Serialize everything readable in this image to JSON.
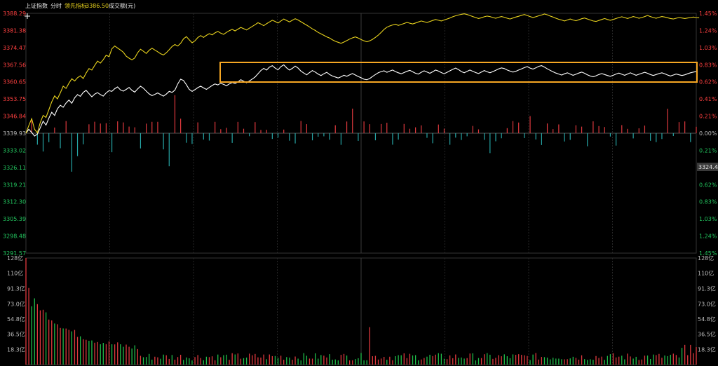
{
  "header": {
    "index_name": "上证指数",
    "mode": "分时",
    "leading_label": "领先指标:",
    "leading_value": "3386.50",
    "volume_label": "成交额(元)"
  },
  "price_ticks": [
    "3388.29",
    "3381.38",
    "3374.47",
    "3367.56",
    "3360.65",
    "3353.75",
    "3346.84",
    "3339.93",
    "3333.02",
    "3326.11",
    "3319.21",
    "3312.30",
    "3305.39",
    "3298.48",
    "3291.57"
  ],
  "pct_ticks": [
    "1.45%",
    "1.24%",
    "1.03%",
    "0.83%",
    "0.62%",
    "0.41%",
    "0.21%",
    "0.00%",
    "0.21%",
    "0.41%",
    "0.62%",
    "0.83%",
    "1.03%",
    "1.24%",
    "1.45%"
  ],
  "volume_ticks": [
    "128亿",
    "110亿",
    "91.3亿",
    "73.0亿",
    "54.8亿",
    "36.5亿",
    "18.3亿"
  ],
  "cursor_price": "3324.40",
  "colors": {
    "background": "#000000",
    "index_line": "#ffffff",
    "leading_line": "#e8d21d",
    "up": "#e0393e",
    "down": "#26a6a6",
    "volume_down": "#1fbf4a",
    "grid": "#2e2e2e",
    "highlight": "#f5a623",
    "tick_up": "#ff4040",
    "tick_down": "#22c55e"
  },
  "chart_data": {
    "type": "line",
    "title": "上证指数 分时",
    "base_price": 3339.93,
    "ylim": [
      3291.57,
      3388.29
    ],
    "volume_ylim": [
      0,
      128
    ],
    "volume_unit": "亿",
    "x_session": "241 one-minute points",
    "series": [
      {
        "name": "上证指数",
        "color": "white",
        "values": [
          3339.93,
          3341.5,
          3340.2,
          3338.8,
          3339.6,
          3342.1,
          3344.8,
          3343.2,
          3346.0,
          3348.4,
          3347.1,
          3349.8,
          3351.2,
          3350.4,
          3352.1,
          3353.3,
          3352.0,
          3354.2,
          3355.5,
          3354.8,
          3356.4,
          3357.2,
          3355.9,
          3354.6,
          3355.7,
          3356.3,
          3355.5,
          3354.9,
          3356.2,
          3357.1,
          3356.8,
          3357.9,
          3358.6,
          3357.4,
          3356.9,
          3357.6,
          3358.4,
          3357.2,
          3356.5,
          3357.8,
          3358.9,
          3358.1,
          3356.9,
          3355.8,
          3355.1,
          3355.6,
          3356.2,
          3355.5,
          3354.9,
          3355.7,
          3356.8,
          3356.4,
          3357.3,
          3359.8,
          3361.7,
          3361.2,
          3359.5,
          3357.6,
          3356.8,
          3357.5,
          3358.3,
          3358.9,
          3358.2,
          3357.6,
          3358.4,
          3359.2,
          3359.8,
          3359.4,
          3360.1,
          3359.6,
          3359.1,
          3359.8,
          3360.4,
          3360.0,
          3360.6,
          3361.5,
          3360.9,
          3360.3,
          3361.0,
          3361.8,
          3362.6,
          3363.9,
          3365.2,
          3366.1,
          3365.4,
          3366.6,
          3367.2,
          3366.2,
          3365.5,
          3366.8,
          3367.5,
          3366.3,
          3365.4,
          3366.1,
          3367.0,
          3366.2,
          3365.0,
          3364.2,
          3363.5,
          3364.4,
          3365.2,
          3364.6,
          3363.8,
          3363.2,
          3363.9,
          3364.5,
          3363.6,
          3363.0,
          3362.6,
          3362.2,
          3362.7,
          3363.3,
          3362.9,
          3363.5,
          3364.0,
          3363.4,
          3362.8,
          3362.3,
          3361.7,
          3361.5,
          3362.0,
          3362.8,
          3363.6,
          3364.3,
          3364.8,
          3365.1,
          3364.5,
          3365.0,
          3365.4,
          3364.8,
          3364.3,
          3363.9,
          3364.4,
          3364.9,
          3365.3,
          3364.7,
          3364.1,
          3363.8,
          3364.5,
          3365.1,
          3364.6,
          3364.1,
          3364.7,
          3365.4,
          3365.0,
          3364.4,
          3363.9,
          3364.5,
          3365.1,
          3365.7,
          3366.2,
          3365.6,
          3364.8,
          3364.3,
          3364.9,
          3365.4,
          3364.9,
          3364.4,
          3364.0,
          3364.6,
          3365.2,
          3364.7,
          3364.3,
          3364.8,
          3365.3,
          3365.9,
          3366.3,
          3366.0,
          3365.4,
          3365.0,
          3364.6,
          3364.9,
          3365.4,
          3365.9,
          3366.4,
          3366.8,
          3366.2,
          3365.8,
          3366.3,
          3366.9,
          3367.2,
          3366.6,
          3365.9,
          3365.3,
          3364.7,
          3364.2,
          3363.8,
          3363.4,
          3363.9,
          3364.3,
          3363.8,
          3363.3,
          3363.7,
          3364.2,
          3364.6,
          3364.1,
          3363.5,
          3363.0,
          3362.7,
          3363.1,
          3363.6,
          3364.0,
          3363.6,
          3363.2,
          3362.9,
          3363.3,
          3363.8,
          3364.2,
          3363.7,
          3363.3,
          3363.8,
          3364.3,
          3363.8,
          3363.3,
          3363.7,
          3364.1,
          3364.5,
          3364.1,
          3363.6,
          3363.2,
          3363.6,
          3364.0,
          3364.3,
          3363.9,
          3363.4,
          3363.0,
          3363.4,
          3363.8,
          3363.5,
          3363.2,
          3363.5,
          3363.9,
          3364.3,
          3364.6,
          3364.8
        ]
      },
      {
        "name": "领先指标",
        "color": "yellow",
        "values": [
          3339.93,
          3343.0,
          3345.8,
          3341.5,
          3340.1,
          3344.2,
          3347.1,
          3346.3,
          3349.4,
          3352.6,
          3355.0,
          3353.8,
          3356.2,
          3358.9,
          3358.0,
          3360.1,
          3361.9,
          3361.0,
          3362.3,
          3363.1,
          3362.0,
          3364.2,
          3366.0,
          3365.4,
          3367.3,
          3369.0,
          3368.2,
          3369.6,
          3371.4,
          3370.8,
          3374.0,
          3375.1,
          3374.3,
          3373.5,
          3372.6,
          3371.0,
          3370.2,
          3369.5,
          3370.3,
          3372.4,
          3373.8,
          3373.0,
          3372.1,
          3373.4,
          3374.2,
          3373.5,
          3372.8,
          3372.0,
          3371.5,
          3372.4,
          3373.6,
          3374.9,
          3375.7,
          3375.1,
          3376.2,
          3378.0,
          3378.9,
          3377.6,
          3376.4,
          3377.2,
          3378.5,
          3379.3,
          3378.6,
          3379.4,
          3380.1,
          3379.6,
          3380.4,
          3381.0,
          3380.3,
          3379.8,
          3380.6,
          3381.3,
          3381.8,
          3381.2,
          3381.9,
          3382.6,
          3382.1,
          3381.6,
          3382.3,
          3383.0,
          3383.7,
          3384.5,
          3384.0,
          3383.3,
          3384.1,
          3384.8,
          3385.5,
          3385.0,
          3384.4,
          3385.2,
          3386.0,
          3385.4,
          3384.8,
          3385.5,
          3386.1,
          3385.6,
          3384.9,
          3384.2,
          3383.5,
          3382.8,
          3382.0,
          3381.4,
          3380.6,
          3380.0,
          3379.4,
          3378.8,
          3378.3,
          3377.6,
          3377.0,
          3376.6,
          3376.2,
          3376.7,
          3377.3,
          3377.9,
          3378.4,
          3378.8,
          3378.3,
          3377.7,
          3377.2,
          3376.8,
          3377.2,
          3377.8,
          3378.6,
          3379.5,
          3380.6,
          3381.8,
          3382.7,
          3383.2,
          3383.6,
          3383.9,
          3383.4,
          3383.8,
          3384.2,
          3384.6,
          3384.3,
          3384.0,
          3384.4,
          3384.8,
          3385.2,
          3384.9,
          3384.6,
          3385.0,
          3385.4,
          3385.8,
          3385.5,
          3385.2,
          3385.6,
          3386.0,
          3386.4,
          3386.9,
          3387.3,
          3387.6,
          3387.9,
          3388.1,
          3387.8,
          3387.4,
          3387.0,
          3386.6,
          3386.2,
          3386.5,
          3386.9,
          3387.2,
          3387.0,
          3386.6,
          3386.3,
          3386.7,
          3387.0,
          3386.7,
          3386.3,
          3386.0,
          3386.4,
          3386.8,
          3387.1,
          3387.5,
          3387.8,
          3387.4,
          3387.0,
          3386.6,
          3386.9,
          3387.3,
          3387.6,
          3388.0,
          3387.7,
          3387.2,
          3386.8,
          3386.3,
          3385.9,
          3385.6,
          3385.2,
          3385.6,
          3386.0,
          3385.6,
          3385.3,
          3385.7,
          3386.1,
          3386.4,
          3386.0,
          3385.6,
          3385.2,
          3385.0,
          3385.4,
          3385.8,
          3386.2,
          3385.8,
          3385.5,
          3385.8,
          3386.2,
          3386.6,
          3386.9,
          3386.6,
          3386.2,
          3386.6,
          3387.0,
          3386.7,
          3386.3,
          3386.6,
          3387.0,
          3387.4,
          3387.0,
          3386.6,
          3386.3,
          3386.7,
          3387.0,
          3386.8,
          3386.5,
          3386.2,
          3386.0,
          3386.3,
          3386.6,
          3386.4,
          3386.2,
          3386.4,
          3386.6,
          3386.8,
          3386.6,
          3386.5
        ]
      }
    ]
  }
}
